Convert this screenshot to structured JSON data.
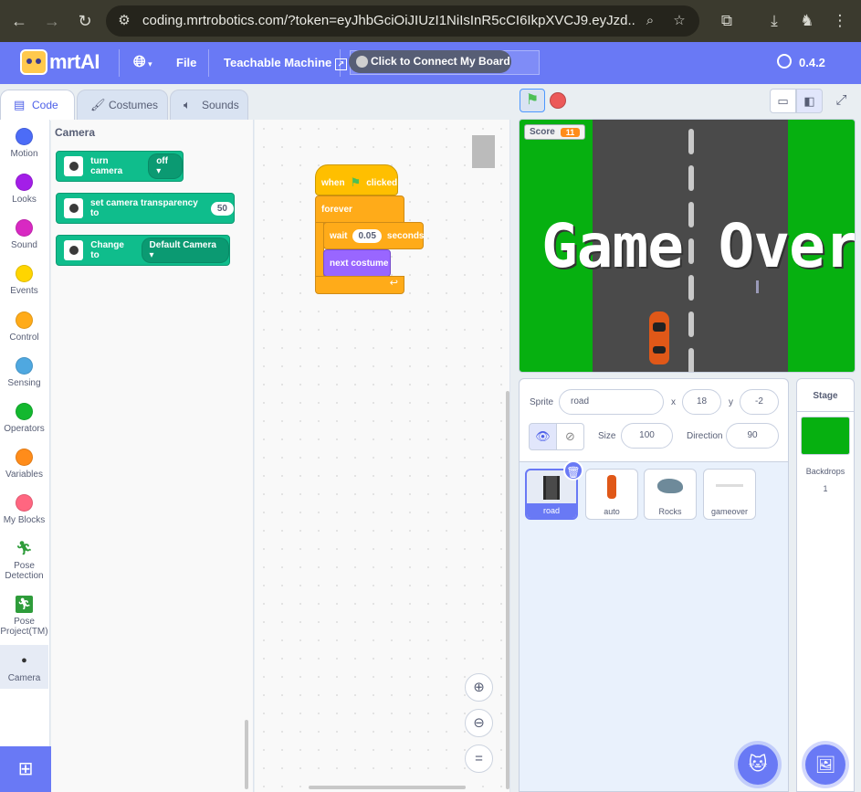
{
  "browser": {
    "url": "coding.mrtrobotics.com/?token=eyJhbGciOiJIUzI1NiIsInR5cCI6IkpXVCJ9.eyJzd..."
  },
  "menu": {
    "logo_text": "mrtAI",
    "file": "File",
    "teachable_machine": "Teachable Machine",
    "connect": "Click to Connect My Board",
    "version": "0.4.2"
  },
  "tabs": {
    "code": "Code",
    "costumes": "Costumes",
    "sounds": "Sounds"
  },
  "categories": [
    {
      "label": "Motion",
      "color": "#4c6cf7"
    },
    {
      "label": "Looks",
      "color": "#a31ee8"
    },
    {
      "label": "Sound",
      "color": "#d829c2"
    },
    {
      "label": "Events",
      "color": "#ffd500"
    },
    {
      "label": "Control",
      "color": "#ffab19"
    },
    {
      "label": "Sensing",
      "color": "#4fa8e0"
    },
    {
      "label": "Operators",
      "color": "#13b82f"
    },
    {
      "label": "Variables",
      "color": "#ff8c1a"
    },
    {
      "label": "My Blocks",
      "color": "#ff6680"
    },
    {
      "label": "Pose\nDetection",
      "icon": "pose-detection-icon"
    },
    {
      "label": "Pose\nProject(TM)",
      "icon": "pose-project-icon"
    },
    {
      "label": "Camera",
      "icon": "camera-icon"
    }
  ],
  "flyout": {
    "title": "Camera",
    "blocks": {
      "turn_camera": "turn camera",
      "turn_camera_value": "off",
      "set_transparency": "set camera transparency to",
      "set_transparency_value": "50",
      "change_to": "Change to",
      "change_to_value": "Default Camera"
    }
  },
  "script": {
    "when": "when",
    "clicked": "clicked",
    "forever": "forever",
    "wait": "wait",
    "wait_value": "0.05",
    "seconds": "seconds",
    "next_costume": "next costume"
  },
  "stage": {
    "score_label": "Score",
    "score_value": "11",
    "game_over": "Game Over"
  },
  "sprite_info": {
    "sprite_label": "Sprite",
    "sprite_name": "road",
    "x_label": "x",
    "x_value": "18",
    "y_label": "y",
    "y_value": "-2",
    "size_label": "Size",
    "size_value": "100",
    "direction_label": "Direction",
    "direction_value": "90"
  },
  "sprites": [
    {
      "name": "road",
      "selected": true
    },
    {
      "name": "auto",
      "selected": false
    },
    {
      "name": "Rocks",
      "selected": false
    },
    {
      "name": "gameover",
      "selected": false
    }
  ],
  "stage_pane": {
    "title": "Stage",
    "backdrops_label": "Backdrops",
    "backdrops_count": "1"
  }
}
